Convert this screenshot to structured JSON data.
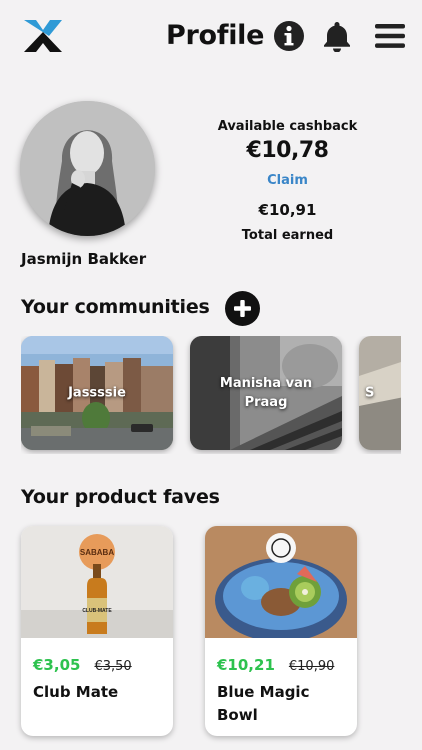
{
  "header": {
    "title": "Profile",
    "icons": [
      "logo-icon",
      "info-icon",
      "bell-icon",
      "menu-icon"
    ]
  },
  "profile": {
    "name": "Jasmijn Bakker",
    "available_label": "Available cashback",
    "available_value": "€10,78",
    "claim_label": "Claim",
    "earned_value": "€10,91",
    "earned_label": "Total earned"
  },
  "communities": {
    "title": "Your communities",
    "items": [
      {
        "label": "Jassssie"
      },
      {
        "label": "Manisha van Praag"
      },
      {
        "label": "S"
      }
    ]
  },
  "faves": {
    "title": "Your product faves",
    "items": [
      {
        "name": "Club Mate",
        "price": "€3,05",
        "old_price": "€3,50",
        "brand_mark": "SABABA",
        "bottle_label": "CLUB-MATE"
      },
      {
        "name": "Blue Magic Bowl",
        "price": "€10,21",
        "old_price": "€10,90"
      }
    ]
  },
  "colors": {
    "claim": "#3a86c8",
    "price": "#2dc24e",
    "background": "#f3f2f3"
  }
}
